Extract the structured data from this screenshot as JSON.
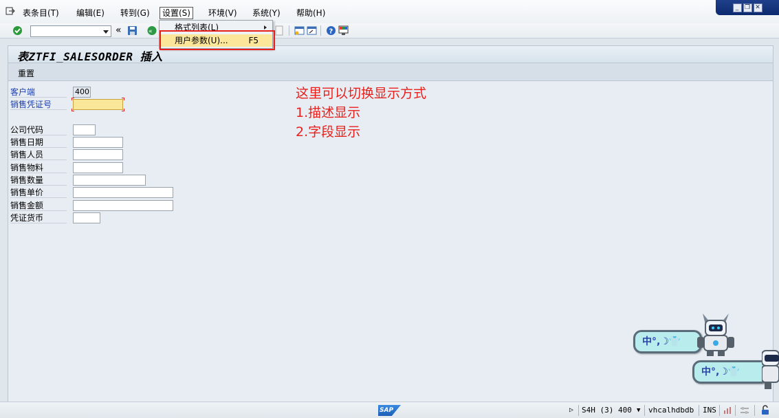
{
  "menu": {
    "items": [
      {
        "label": "表条目(T)"
      },
      {
        "label": "编辑(E)"
      },
      {
        "label": "转到(G)"
      },
      {
        "label": "设置(S)"
      },
      {
        "label": "环境(V)"
      },
      {
        "label": "系统(Y)"
      },
      {
        "label": "帮助(H)"
      }
    ]
  },
  "settings_menu": {
    "items": [
      {
        "label": "格式列表(L)",
        "has_submenu": true
      },
      {
        "label": "用户参数(U)...",
        "shortcut": "F5",
        "selected": true
      }
    ]
  },
  "toolbar": {
    "command_field": {
      "value": ""
    }
  },
  "title": "表ZTFI_SALESORDER 插入",
  "app_toolbar": {
    "reset_label": "重置"
  },
  "form": {
    "fields": [
      {
        "label": "客户端",
        "value": "400",
        "key": true
      },
      {
        "label": "销售凭证号",
        "value": "",
        "key": true
      },
      {
        "label": "公司代码",
        "value": ""
      },
      {
        "label": "销售日期",
        "value": ""
      },
      {
        "label": "销售人员",
        "value": ""
      },
      {
        "label": "销售物料",
        "value": ""
      },
      {
        "label": "销售数量",
        "value": ""
      },
      {
        "label": "销售单价",
        "value": ""
      },
      {
        "label": "销售金额",
        "value": ""
      },
      {
        "label": "凭证货币",
        "value": ""
      }
    ]
  },
  "annotation": {
    "lines": [
      "这里可以切换显示方式",
      "1.描述显示",
      "2.字段显示"
    ],
    "color": "#e8201c"
  },
  "ime_widget": {
    "text": "中°,☽👕"
  },
  "statusbar": {
    "system": "S4H (3) 400",
    "server": "vhcalhdbdb",
    "mode": "INS"
  },
  "colors": {
    "key_label": "#1c3fb3",
    "focus_field": "#fbe79a",
    "highlight_border": "#e8201c"
  }
}
